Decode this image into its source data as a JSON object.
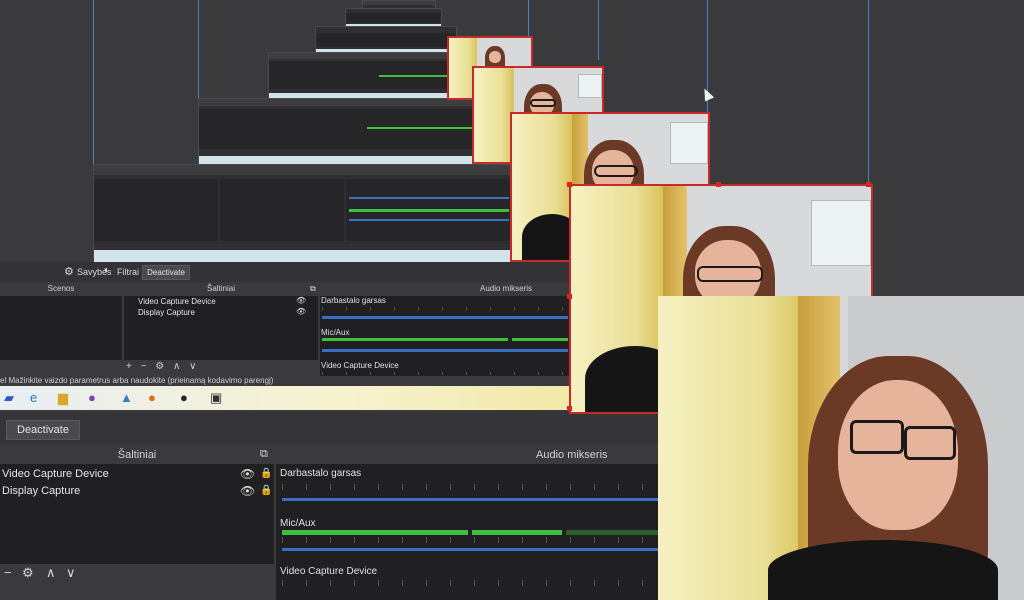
{
  "toolbar": {
    "properties_label": "Savybės",
    "filters_label": "Filtrai",
    "deactivate_label": "Deactivate"
  },
  "scenes": {
    "header": "Scenos"
  },
  "sources": {
    "header": "Šaltiniai",
    "items": [
      {
        "label": "Video Capture Device"
      },
      {
        "label": "Display Capture"
      }
    ],
    "controls": [
      "+",
      "−",
      "⚙",
      "∧",
      "∨"
    ]
  },
  "mixer": {
    "header": "Audio mikseris",
    "channels": [
      {
        "label": "Darbastalo garsas",
        "level": 0.0
      },
      {
        "label": "Mic/Aux",
        "level": 0.92
      },
      {
        "label": "Video Capture Device",
        "level": 0.0
      }
    ],
    "ticks": [
      "-60",
      "-55",
      "-50",
      "-45",
      "-40",
      "-35",
      "-30",
      "-25",
      "-20",
      "-15",
      "-10",
      "-5",
      "0"
    ]
  },
  "hint": {
    "text": "el Mažinkite vaizdo parametrus arba naudokite (prieinamą kodavimo parengį)"
  },
  "icons": {
    "eye": "eye-icon",
    "lock": "lock-icon",
    "gear": "gear-icon",
    "filter": "filter-icon",
    "copy": "copy-icon"
  },
  "colors": {
    "selection_border": "#c62a2a",
    "guide": "#4a7fc9",
    "meter_active": "#3fbf3f",
    "volume_slider": "#3b6fc4"
  }
}
